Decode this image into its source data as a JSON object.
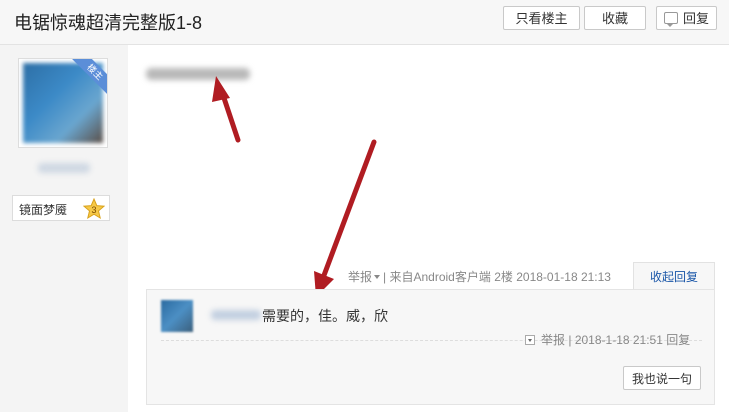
{
  "header": {
    "title": "电锯惊魂超清完整版1-8",
    "buttons": {
      "only_op": "只看楼主",
      "favorite": "收藏",
      "reply": "回复"
    }
  },
  "author": {
    "corner_badge": "楼主",
    "level_name": "镜面梦魇",
    "level": "3"
  },
  "post": {
    "meta": {
      "report": "举报",
      "separator": "|",
      "source": "来自Android客户端",
      "floor": "2楼",
      "time": "2018-01-18 21:13"
    },
    "collapse_label": "收起回复"
  },
  "reply": {
    "text": "需要的，佳。威，欣",
    "report": "举报",
    "separator": "|",
    "time": "2018-1-18 21:51",
    "reply_label": "回复",
    "say_button": "我也说一句"
  },
  "colors": {
    "arrow": "#b01c22",
    "link": "#1b57a8",
    "corner": "#5b8ed8"
  }
}
